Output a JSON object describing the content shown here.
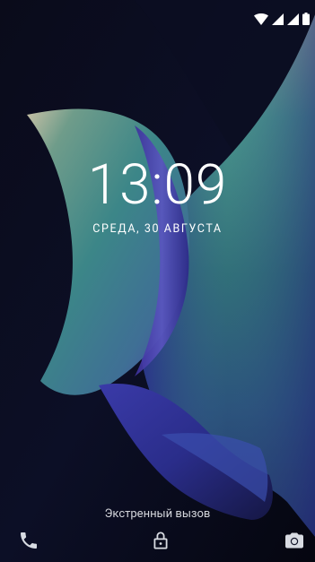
{
  "lockscreen": {
    "time": "13:09",
    "date": "СРЕДА, 30 АВГУСТА",
    "emergency_call_label": "Экстренный вызов"
  },
  "status_bar": {
    "icons": [
      "wifi-icon",
      "signal-icon",
      "signal-icon",
      "battery-icon"
    ]
  },
  "bottom_bar": {
    "icons": [
      "phone-icon",
      "lock-icon",
      "camera-icon"
    ]
  },
  "colors": {
    "text": "#ffffff",
    "secondary_text": "#d4d6dc",
    "background": "#05060a",
    "wallpaper_teal": "#3d8a88",
    "wallpaper_indigo": "#2f2f9a"
  }
}
